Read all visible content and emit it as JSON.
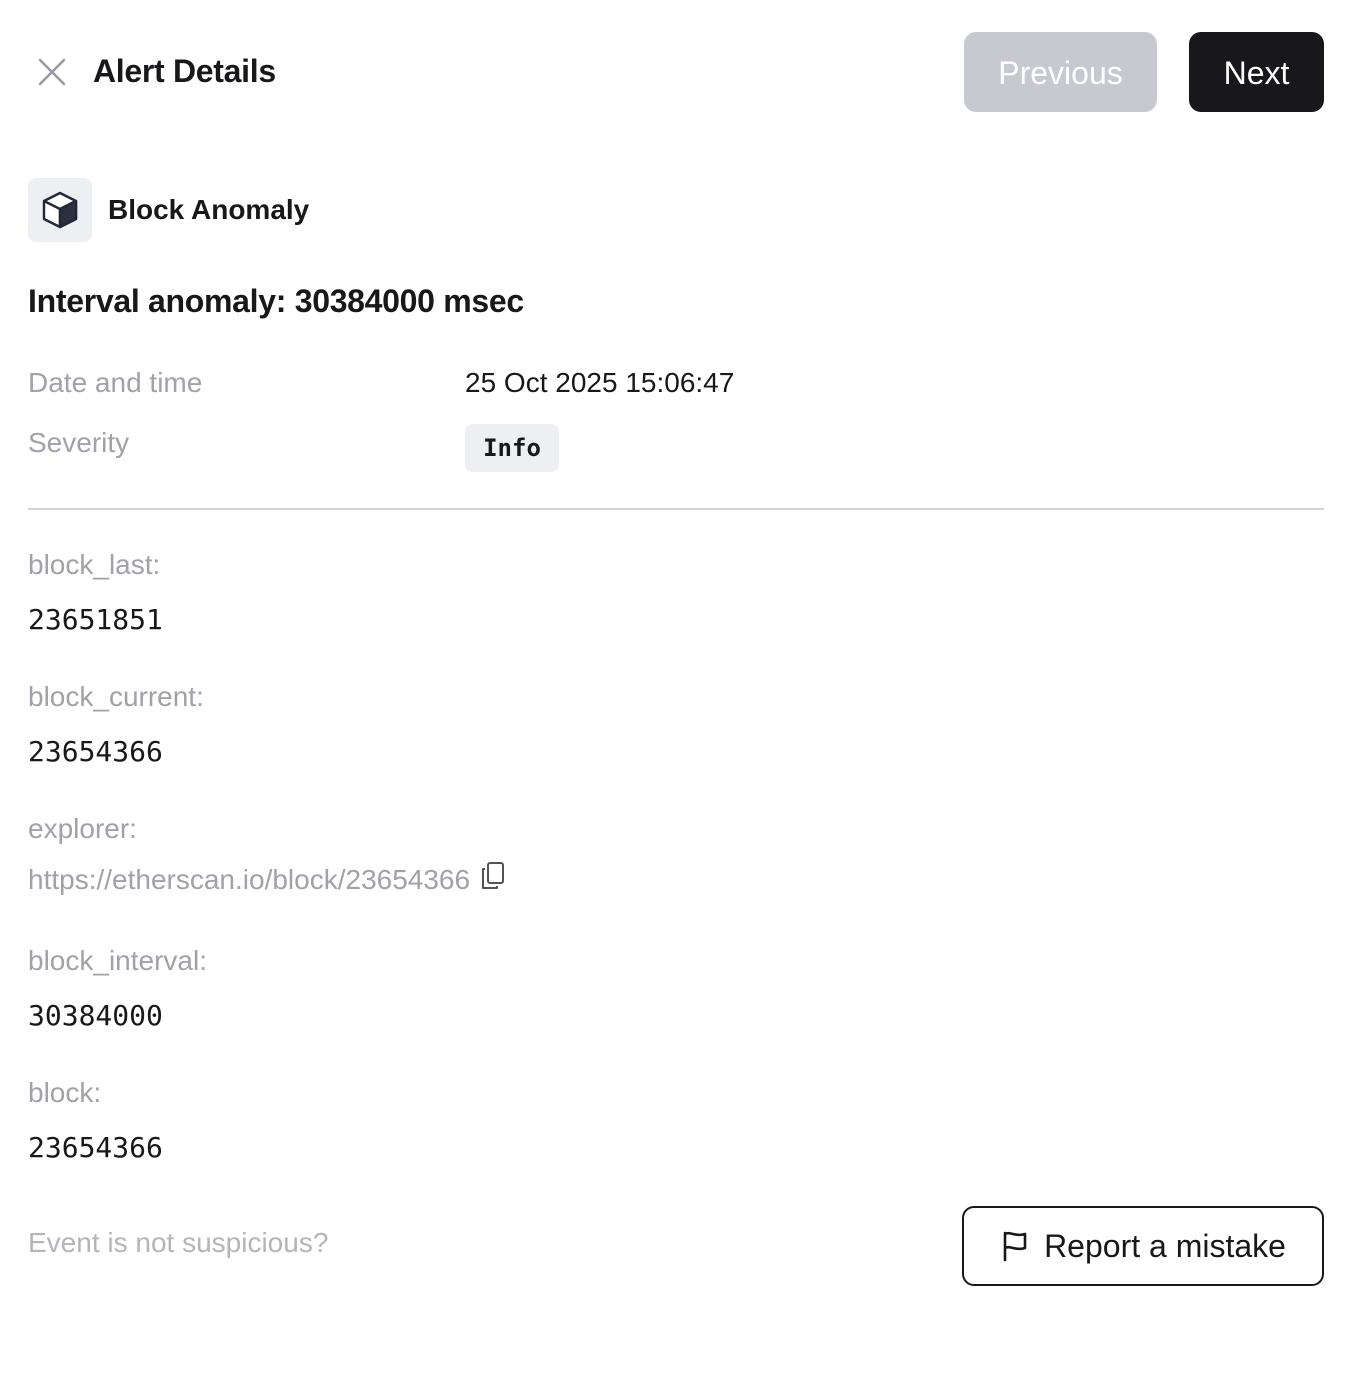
{
  "header": {
    "title": "Alert Details",
    "close_icon": "close-icon",
    "previous_label": "Previous",
    "next_label": "Next",
    "previous_disabled": true
  },
  "alert": {
    "type_label": "Block Anomaly",
    "type_icon": "cube-icon",
    "heading": "Interval anomaly: 30384000 msec"
  },
  "meta": {
    "date_label": "Date and time",
    "date_value": "25 Oct 2025 15:06:47",
    "severity_label": "Severity",
    "severity_value": "Info"
  },
  "fields": [
    {
      "key": "block_last:",
      "value": "23651851"
    },
    {
      "key": "block_current:",
      "value": "23654366"
    },
    {
      "key": "explorer:",
      "value": "https://etherscan.io/block/23654366",
      "copy_icon": "copy-icon"
    },
    {
      "key": "block_interval:",
      "value": "30384000"
    },
    {
      "key": "block:",
      "value": "23654366"
    }
  ],
  "footer": {
    "question": "Event is not suspicious?",
    "report_label": "Report a mistake",
    "report_icon": "flag-icon"
  },
  "colors": {
    "primary_button": "#18181b",
    "disabled_button": "#c8c9d0",
    "muted_text": "#a1a1aa",
    "badge_background": "#eeeff3"
  }
}
